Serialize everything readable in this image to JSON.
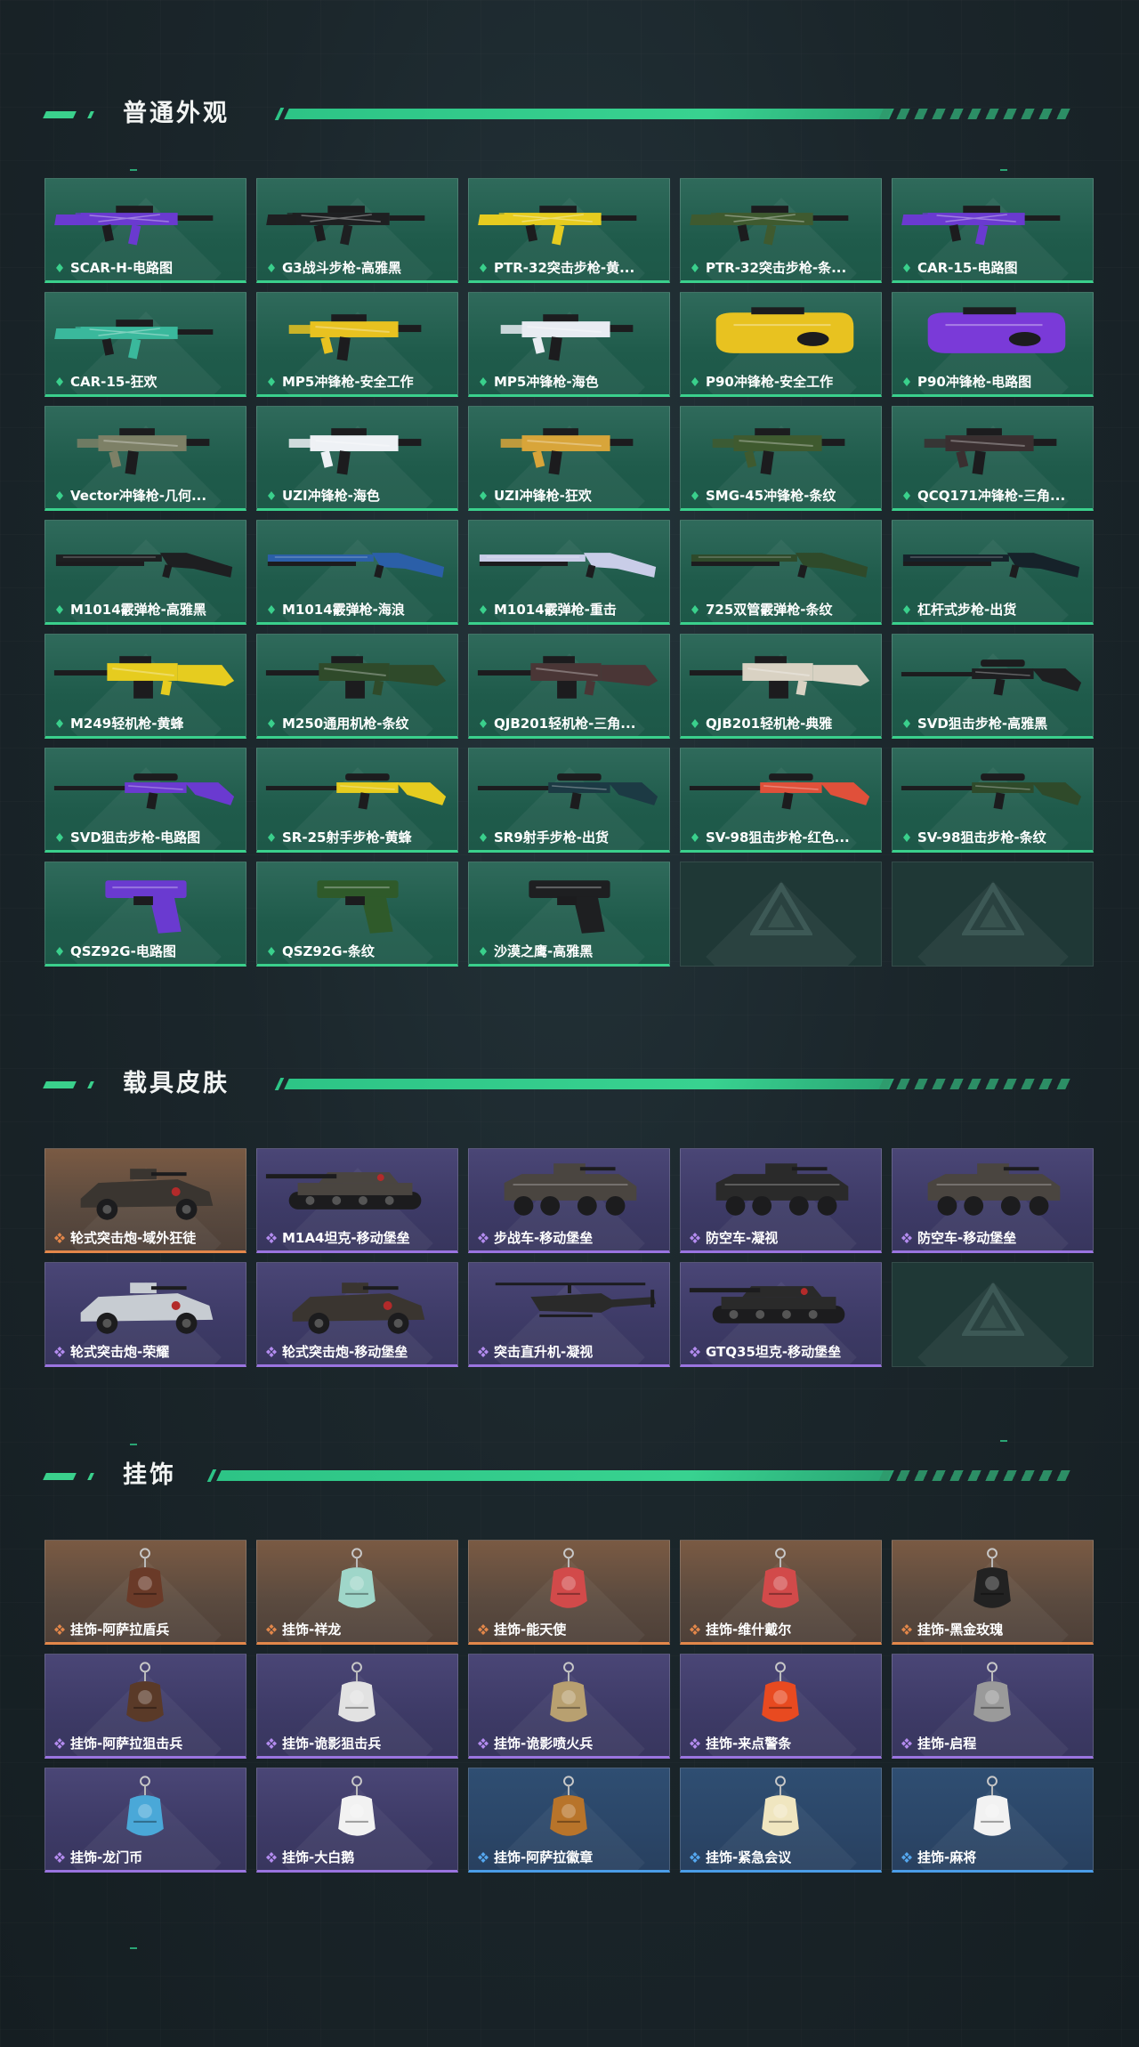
{
  "sections": [
    {
      "title": "普通外观",
      "rarity": "green",
      "items": [
        {
          "label": "SCAR-H-电路图",
          "kind": "rifle",
          "color": "#6a3ad0"
        },
        {
          "label": "G3战斗步枪-高雅黑",
          "kind": "rifle",
          "color": "#1e1f21"
        },
        {
          "label": "PTR-32突击步枪-黄...",
          "kind": "rifle",
          "color": "#e6cc1f"
        },
        {
          "label": "PTR-32突击步枪-条...",
          "kind": "rifle",
          "color": "#3f5a2f"
        },
        {
          "label": "CAR-15-电路图",
          "kind": "rifle",
          "color": "#6a3ad0"
        },
        {
          "label": "CAR-15-狂欢",
          "kind": "rifle",
          "color": "#3ab89c"
        },
        {
          "label": "MP5冲锋枪-安全工作",
          "kind": "smg",
          "color": "#e8c220"
        },
        {
          "label": "MP5冲锋枪-海色",
          "kind": "smg",
          "color": "#e8ecf2"
        },
        {
          "label": "P90冲锋枪-安全工作",
          "kind": "bullpup",
          "color": "#e8c220"
        },
        {
          "label": "P90冲锋枪-电路图",
          "kind": "bullpup",
          "color": "#7a3ad8"
        },
        {
          "label": "Vector冲锋枪-几何...",
          "kind": "smg",
          "color": "#7d8066"
        },
        {
          "label": "UZI冲锋枪-海色",
          "kind": "smg",
          "color": "#eef1f5"
        },
        {
          "label": "UZI冲锋枪-狂欢",
          "kind": "smg",
          "color": "#d8a53a"
        },
        {
          "label": "SMG-45冲锋枪-条纹",
          "kind": "smg",
          "color": "#3f5a2f"
        },
        {
          "label": "QCQ171冲锋枪-三角...",
          "kind": "smg",
          "color": "#3a2f30"
        },
        {
          "label": "M1014霰弹枪-高雅黑",
          "kind": "shotgun",
          "color": "#1e1f21"
        },
        {
          "label": "M1014霰弹枪-海浪",
          "kind": "shotgun",
          "color": "#2b5fa8"
        },
        {
          "label": "M1014霰弹枪-重击",
          "kind": "shotgun",
          "color": "#c9cde8"
        },
        {
          "label": "725双管霰弹枪-条纹",
          "kind": "shotgun",
          "color": "#2f4a2a"
        },
        {
          "label": "杠杆式步枪-出货",
          "kind": "shotgun",
          "color": "#16222a"
        },
        {
          "label": "M249轻机枪-黄蜂",
          "kind": "lmg",
          "color": "#e6cc1f"
        },
        {
          "label": "M250通用机枪-条纹",
          "kind": "lmg",
          "color": "#2f4a2a"
        },
        {
          "label": "QJB201轻机枪-三角...",
          "kind": "lmg",
          "color": "#4a3636"
        },
        {
          "label": "QJB201轻机枪-典雅",
          "kind": "lmg",
          "color": "#d9d2c3"
        },
        {
          "label": "SVD狙击步枪-高雅黑",
          "kind": "sniper",
          "color": "#1e1f21"
        },
        {
          "label": "SVD狙击步枪-电路图",
          "kind": "sniper",
          "color": "#6a3ad0"
        },
        {
          "label": "SR-25射手步枪-黄蜂",
          "kind": "sniper",
          "color": "#e6cc1f"
        },
        {
          "label": "SR9射手步枪-出货",
          "kind": "sniper",
          "color": "#1c3a44"
        },
        {
          "label": "SV-98狙击步枪-红色...",
          "kind": "sniper",
          "color": "#e0503a"
        },
        {
          "label": "SV-98狙击步枪-条纹",
          "kind": "sniper",
          "color": "#2f4a2a"
        },
        {
          "label": "QSZ92G-电路图",
          "kind": "pistol",
          "color": "#6a3ad0"
        },
        {
          "label": "QSZ92G-条纹",
          "kind": "pistol",
          "color": "#2f5a2a"
        },
        {
          "label": "沙漠之鹰-高雅黑",
          "kind": "pistol",
          "color": "#1e1f21"
        },
        {
          "label": "",
          "kind": "empty",
          "color": ""
        },
        {
          "label": "",
          "kind": "empty",
          "color": ""
        }
      ]
    },
    {
      "title": "载具皮肤",
      "rarity": "purple",
      "items": [
        {
          "label": "轮式突击炮-域外狂徒",
          "kind": "buggy",
          "color": "#3a3530",
          "rarity": "orange"
        },
        {
          "label": "M1A4坦克-移动堡垒",
          "kind": "tank",
          "color": "#4a4540",
          "rarity": "purple"
        },
        {
          "label": "步战车-移动堡垒",
          "kind": "apc",
          "color": "#4a4540",
          "rarity": "purple"
        },
        {
          "label": "防空车-凝视",
          "kind": "apc",
          "color": "#2a2a2a",
          "rarity": "purple"
        },
        {
          "label": "防空车-移动堡垒",
          "kind": "apc",
          "color": "#4a4540",
          "rarity": "purple"
        },
        {
          "label": "轮式突击炮-荣耀",
          "kind": "buggy",
          "color": "#c7ccd2",
          "rarity": "purple"
        },
        {
          "label": "轮式突击炮-移动堡垒",
          "kind": "buggy",
          "color": "#3a3530",
          "rarity": "purple"
        },
        {
          "label": "突击直升机-凝视",
          "kind": "heli",
          "color": "#2a2a2a",
          "rarity": "purple"
        },
        {
          "label": "GTQ35坦克-移动堡垒",
          "kind": "tank",
          "color": "#2a2a2a",
          "rarity": "purple"
        },
        {
          "label": "",
          "kind": "empty",
          "color": "",
          "rarity": "empty"
        }
      ]
    },
    {
      "title": "挂饰",
      "rarity": "orange",
      "items": [
        {
          "label": "挂饰-阿萨拉盾兵",
          "kind": "charm",
          "color": "#6a3a28",
          "rarity": "orange"
        },
        {
          "label": "挂饰-祥龙",
          "kind": "charm",
          "color": "#9fd6c9",
          "rarity": "orange"
        },
        {
          "label": "挂饰-能天使",
          "kind": "charm",
          "color": "#d24a4a",
          "rarity": "orange"
        },
        {
          "label": "挂饰-维什戴尔",
          "kind": "charm",
          "color": "#d24a4a",
          "rarity": "orange"
        },
        {
          "label": "挂饰-黑金玫瑰",
          "kind": "charm",
          "color": "#222222",
          "rarity": "orange"
        },
        {
          "label": "挂饰-阿萨拉狙击兵",
          "kind": "charm",
          "color": "#5a3a28",
          "rarity": "purple"
        },
        {
          "label": "挂饰-诡影狙击兵",
          "kind": "charm",
          "color": "#e2e2e2",
          "rarity": "purple"
        },
        {
          "label": "挂饰-诡影喷火兵",
          "kind": "charm",
          "color": "#b8a070",
          "rarity": "purple"
        },
        {
          "label": "挂饰-来点警条",
          "kind": "charm",
          "color": "#e84a20",
          "rarity": "purple"
        },
        {
          "label": "挂饰-启程",
          "kind": "charm",
          "color": "#9a9a9a",
          "rarity": "purple"
        },
        {
          "label": "挂饰-龙门币",
          "kind": "charm",
          "color": "#4aa8d8",
          "rarity": "purple"
        },
        {
          "label": "挂饰-大白鹅",
          "kind": "charm",
          "color": "#f2f2f2",
          "rarity": "purple"
        },
        {
          "label": "挂饰-阿萨拉徽章",
          "kind": "charm",
          "color": "#b8742a",
          "rarity": "blue"
        },
        {
          "label": "挂饰-紧急会议",
          "kind": "charm",
          "color": "#f0e6c0",
          "rarity": "blue"
        },
        {
          "label": "挂饰-麻将",
          "kind": "charm",
          "color": "#f2f2f2",
          "rarity": "blue"
        }
      ]
    }
  ],
  "colors": {
    "accent": "#3ad08c",
    "green": "#3ad08c",
    "orange": "#e3874a",
    "purple": "#9a74e0",
    "blue": "#4a9de8"
  }
}
